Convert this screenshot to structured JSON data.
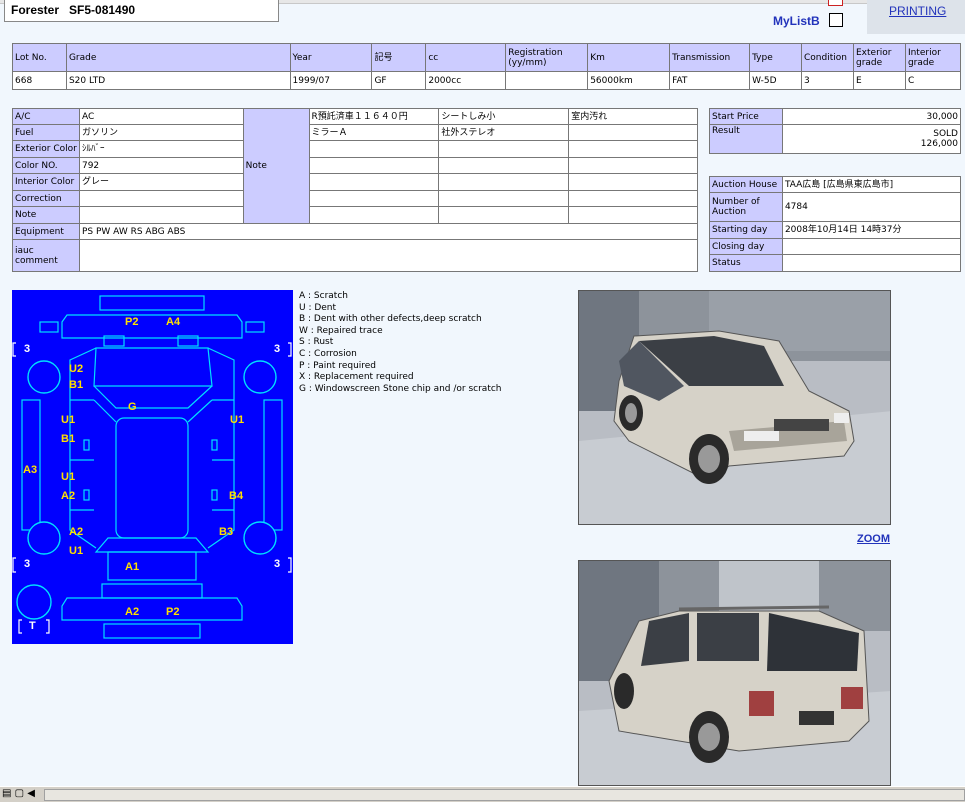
{
  "header": {
    "title": "Forester   SF5-081490",
    "printing_link": "PRINTING",
    "mylist_label": "MyListB",
    "zoom_link": "ZOOM"
  },
  "lot_table": {
    "headers": [
      "Lot No.",
      "Grade",
      "Year",
      "記号",
      "cc",
      "Registration\n(yy/mm)",
      "Km",
      "Transmission",
      "Type",
      "Condition",
      "Exterior\ngrade",
      "Interior\ngrade"
    ],
    "values": [
      "668",
      "S20 LTD",
      "1999/07",
      "GF",
      "2000cc",
      "",
      "56000km",
      "FAT",
      "W-5D",
      "3",
      "E",
      "C"
    ]
  },
  "details": {
    "rows": [
      {
        "label": "A/C",
        "value": "AC"
      },
      {
        "label": "Fuel",
        "value": "ガソリン"
      },
      {
        "label": "Exterior Color",
        "value": "ｼﾙﾊﾞｰ"
      },
      {
        "label": "Color NO.",
        "value": "792"
      },
      {
        "label": "Interior Color",
        "value": "グレー"
      },
      {
        "label": "Correction",
        "value": ""
      },
      {
        "label": "Note",
        "value": ""
      }
    ],
    "note_label": "Note",
    "note_cells": [
      [
        "R預託済車１１６４０円",
        "シートしみ小",
        "室内汚れ"
      ],
      [
        "ミラーＡ",
        "社外ステレオ",
        ""
      ],
      [
        "",
        "",
        ""
      ],
      [
        "",
        "",
        ""
      ],
      [
        "",
        "",
        ""
      ],
      [
        "",
        "",
        ""
      ],
      [
        "",
        "",
        ""
      ]
    ],
    "equipment_label": "Equipment",
    "equipment_value": "PS PW AW RS ABG ABS",
    "iauc_label": "iauc\ncomment",
    "iauc_value": ""
  },
  "price": {
    "start_label": "Start Price",
    "start_value": "30,000",
    "result_label": "Result",
    "result_line1": "SOLD",
    "result_line2": "126,000"
  },
  "auction": {
    "rows": [
      {
        "label": "Auction House",
        "value": "TAA広島 [広島県東広島市]"
      },
      {
        "label": "Number of\nAuction",
        "value": "4784"
      },
      {
        "label": "Starting day",
        "value": "2008年10月14日 14時37分"
      },
      {
        "label": "Closing day",
        "value": ""
      },
      {
        "label": "Status",
        "value": ""
      }
    ]
  },
  "legend": [
    "A : Scratch",
    "U : Dent",
    "B : Dent with other defects,deep scratch",
    "W : Repaired trace",
    "S : Rust",
    "C : Corrosion",
    "P : Paint required",
    "X : Replacement required",
    "G : Windowscreen Stone chip and /or scratch"
  ],
  "diagram_labels": {
    "top_p2": "P2",
    "top_a4": "A4",
    "u2": "U2",
    "b1_top": "B1",
    "g": "G",
    "u1_l1": "U1",
    "b1_l": "B1",
    "u1_r1": "U1",
    "a3": "A3",
    "u1_l2": "U1",
    "a2_l": "A2",
    "b4": "B4",
    "a2_l2": "A2",
    "u1_l3": "U1",
    "b3": "B3",
    "a1": "A1",
    "bot_a2": "A2",
    "bot_p2": "P2",
    "tire_tl": "3",
    "tire_tr": "3",
    "tire_bl": "3",
    "tire_br": "3",
    "spare": "T"
  },
  "colors": {
    "header_cell": "#ccccff",
    "diagram_bg": "#0000ff",
    "diagram_line": "#00e0ff",
    "diagram_text": "#ffe000",
    "link": "#2233bb"
  }
}
